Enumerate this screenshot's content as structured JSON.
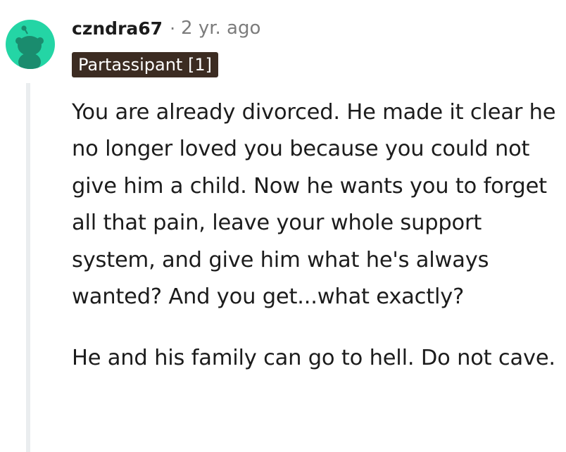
{
  "comment": {
    "author": "czndra67",
    "separator": "·",
    "timestamp": "2 yr. ago",
    "flair": "Partassipant [1]",
    "paragraphs": [
      "You are already divorced. He made it clear he no longer loved you because you could not give him a child. Now he wants you to forget all that pain, leave your whole support system, and give him what he's always wanted? And you get...what exactly?",
      "He and his family can go to hell. Do not cave."
    ]
  },
  "avatar": {
    "icon": "reddit-snoo-icon",
    "background_color": "#24d5a5"
  },
  "colors": {
    "flair_background": "#3c2c22",
    "thread_line": "#eaedef",
    "meta_text": "#7c7c7c",
    "body_text": "#1c1c1c"
  }
}
